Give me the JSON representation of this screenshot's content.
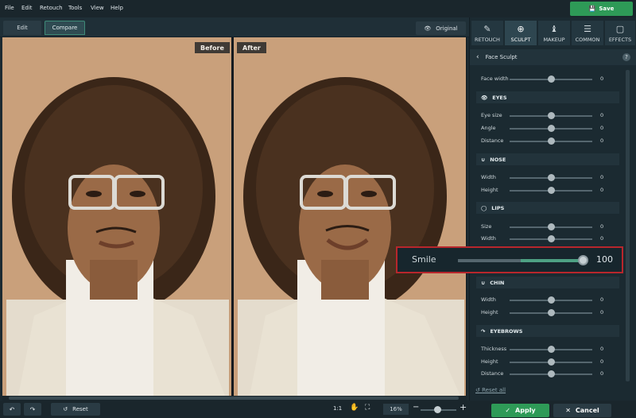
{
  "menu": [
    "File",
    "Edit",
    "Retouch",
    "Tools",
    "View",
    "Help"
  ],
  "save_label": "Save",
  "tabs": {
    "edit": "Edit",
    "compare": "Compare"
  },
  "original_label": "Original",
  "before_label": "Before",
  "after_label": "After",
  "panel_tabs": [
    {
      "label": "RETOUCH",
      "icon": "retouch-icon"
    },
    {
      "label": "SCULPT",
      "icon": "sculpt-icon"
    },
    {
      "label": "MAKEUP",
      "icon": "makeup-icon"
    },
    {
      "label": "COMMON",
      "icon": "common-icon"
    },
    {
      "label": "EFFECTS",
      "icon": "effects-icon"
    }
  ],
  "panel_title": "Face Sculpt",
  "face_width": {
    "label": "Face width",
    "value": "0"
  },
  "sections": {
    "eyes": "EYES",
    "nose": "NOSE",
    "lips": "LIPS",
    "chin": "CHIN",
    "eyebrows": "EYEBROWS"
  },
  "eyes": [
    {
      "label": "Eye size",
      "value": "0"
    },
    {
      "label": "Angle",
      "value": "0"
    },
    {
      "label": "Distance",
      "value": "0"
    }
  ],
  "nose": [
    {
      "label": "Width",
      "value": "0"
    },
    {
      "label": "Height",
      "value": "0"
    }
  ],
  "lips": [
    {
      "label": "Size",
      "value": "0"
    },
    {
      "label": "Width",
      "value": "0"
    }
  ],
  "smile": {
    "label": "Smile",
    "value": "100",
    "level": 1.0
  },
  "chin": [
    {
      "label": "Width",
      "value": "0"
    },
    {
      "label": "Height",
      "value": "0"
    }
  ],
  "eyebrows": [
    {
      "label": "Thickness",
      "value": "0"
    },
    {
      "label": "Height",
      "value": "0"
    },
    {
      "label": "Distance",
      "value": "0"
    }
  ],
  "reset_all": "Reset all",
  "bottom": {
    "reset": "Reset",
    "one_to_one": "1:1",
    "zoom": "16%",
    "zoom_level": 0.5,
    "apply": "Apply",
    "cancel": "Cancel"
  }
}
